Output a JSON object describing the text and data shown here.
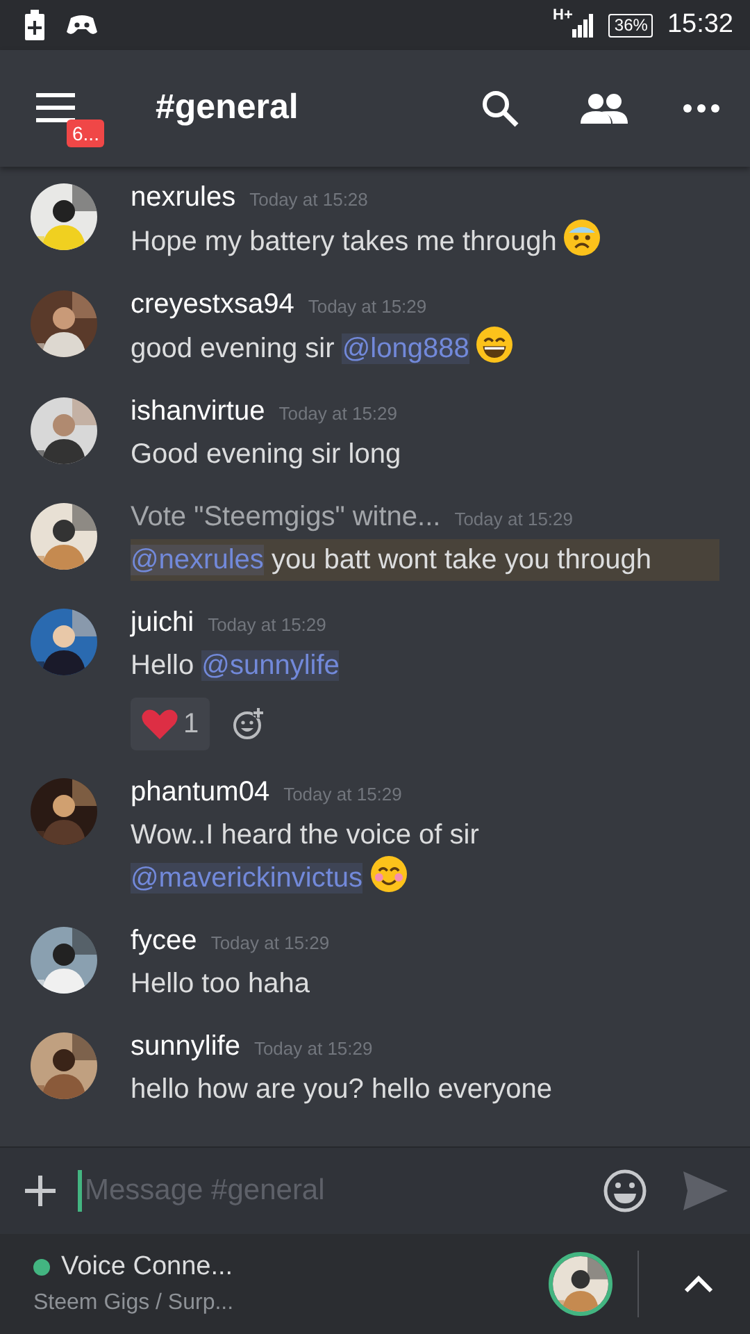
{
  "status_bar": {
    "network": "H+",
    "battery": "36%",
    "time": "15:32"
  },
  "header": {
    "badge": "6...",
    "channel": "#general"
  },
  "messages": [
    {
      "author": "nexrules",
      "time": "Today at 15:28",
      "color": "#ffffff",
      "highlighted": false,
      "body": [
        {
          "kind": "text",
          "text": "Hope my battery takes me through"
        },
        {
          "kind": "worried"
        }
      ]
    },
    {
      "author": "creyestxsa94",
      "time": "Today at 15:29",
      "color": "#ffffff",
      "highlighted": false,
      "body": [
        {
          "kind": "text",
          "text": "good evening sir"
        },
        {
          "kind": "mention",
          "text": "@long888"
        },
        {
          "kind": "grin"
        }
      ]
    },
    {
      "author": "ishanvirtue",
      "time": "Today at 15:29",
      "color": "#ffffff",
      "highlighted": false,
      "body": [
        {
          "kind": "text",
          "text": "Good evening sir long"
        }
      ]
    },
    {
      "author": "Vote \"Steemgigs\" witne...",
      "time": "Today at 15:29",
      "color": "#a3a6aa",
      "highlighted": true,
      "body": [
        {
          "kind": "mention",
          "text": "@nexrules"
        },
        {
          "kind": "text",
          "text": "you batt wont take you through"
        }
      ]
    },
    {
      "author": "juichi",
      "time": "Today at 15:29",
      "color": "#ffffff",
      "highlighted": false,
      "body": [
        {
          "kind": "text",
          "text": "Hello"
        },
        {
          "kind": "mention",
          "text": "@sunnylife"
        }
      ],
      "reactions": [
        {
          "count": "1"
        }
      ]
    },
    {
      "author": "phantum04",
      "time": "Today at 15:29",
      "color": "#ffffff",
      "highlighted": false,
      "body": [
        {
          "kind": "text",
          "text": "Wow..I heard the voice of sir"
        },
        {
          "kind": "break"
        },
        {
          "kind": "mention",
          "text": "@maverickinvictus"
        },
        {
          "kind": "blush"
        }
      ]
    },
    {
      "author": "fycee",
      "time": "Today at 15:29",
      "color": "#ffffff",
      "highlighted": false,
      "body": [
        {
          "kind": "text",
          "text": "Hello too haha"
        }
      ]
    },
    {
      "author": "sunnylife",
      "time": "Today at 15:29",
      "color": "#ffffff",
      "highlighted": false,
      "body": [
        {
          "kind": "text",
          "text": "hello how are you? hello everyone"
        }
      ]
    }
  ],
  "composer": {
    "placeholder": "Message #general"
  },
  "voice": {
    "status": "Voice Conne...",
    "channel": "Steem Gigs / Surp...",
    "color": "#43b581"
  }
}
